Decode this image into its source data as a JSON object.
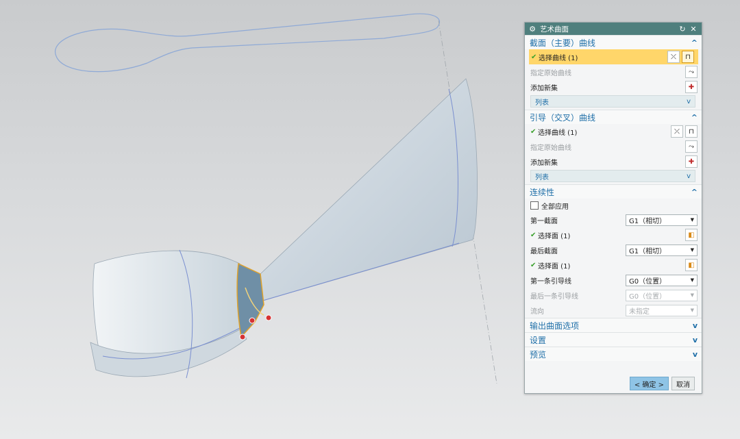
{
  "dialog": {
    "title": "艺术曲面",
    "section_curves": {
      "title": "截面（主要）曲线",
      "select_label": "选择曲线 (1)",
      "orig_label": "指定原始曲线",
      "add_label": "添加新集",
      "list_label": "列表"
    },
    "guide_curves": {
      "title": "引导（交叉）曲线",
      "select_label": "选择曲线 (1)",
      "orig_label": "指定原始曲线",
      "add_label": "添加新集",
      "list_label": "列表"
    },
    "continuity": {
      "title": "连续性",
      "apply_all_label": "全部应用",
      "first_section_label": "第一截面",
      "first_section_value": "G1（相切）",
      "select_face_1": "选择面 (1)",
      "last_section_label": "最后截面",
      "last_section_value": "G1（相切）",
      "select_face_2": "选择面 (1)",
      "first_guide_label": "第一条引导线",
      "first_guide_value": "G0（位置）",
      "last_guide_label": "最后一条引导线",
      "last_guide_value": "G0（位置）",
      "flow_label": "流向",
      "flow_value": "未指定"
    },
    "output_options": "输出曲面选项",
    "settings": "设置",
    "preview": "预览",
    "ok": "< 确定 >",
    "cancel": "取消"
  },
  "icons": {
    "title": "gear-icon",
    "reset": "reset-icon",
    "close": "close-icon",
    "expand": "chevron-up-icon",
    "collapse": "chevron-down-icon",
    "select_curve": "curve-select-icon",
    "swap": "swap-icon",
    "add": "add-set-icon",
    "face": "face-select-icon"
  },
  "colors": {
    "title_bar": "#4f7f7d",
    "section_title": "#1f6fa8",
    "highlight": "#ffd66a",
    "check": "#3aa02c"
  }
}
